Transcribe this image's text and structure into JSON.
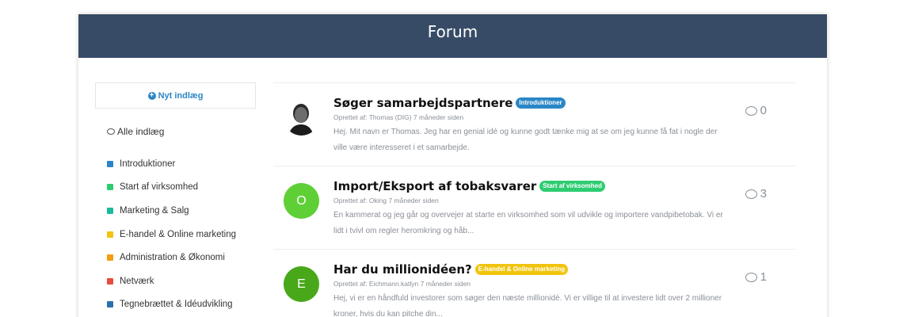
{
  "header": {
    "title": "Forum"
  },
  "sidebar": {
    "new_post_label": "Nyt indlæg",
    "all_posts_label": "Alle indlæg",
    "categories": [
      {
        "label": "Introduktioner",
        "color": "#2a86c6"
      },
      {
        "label": "Start af virksomhed",
        "color": "#2ecc71"
      },
      {
        "label": "Marketing & Salg",
        "color": "#1abc9c"
      },
      {
        "label": "E-handel & Online marketing",
        "color": "#f1c40f"
      },
      {
        "label": "Administration & Økonomi",
        "color": "#f39c12"
      },
      {
        "label": "Netværk",
        "color": "#e74c3c"
      },
      {
        "label": "Tegnebrættet & Idéudvikling",
        "color": "#2a6fb0"
      }
    ]
  },
  "posts": [
    {
      "title": "Søger samarbejdspartnere",
      "badge": "Introduktioner",
      "badge_color": "#2a86c6",
      "meta": "Oprettet af: Thomas (DIG) 7 måneder siden",
      "excerpt": "Hej. Mit navn er Thomas. Jeg har en genial idé og kunne godt tænke mig at se om jeg kunne få fat i nogle der ville være interesseret i et samarbejde.",
      "avatar_type": "photo",
      "comments": "0"
    },
    {
      "title": "Import/Eksport af tobaksvarer",
      "badge": "Start af virksomhed",
      "badge_color": "#2ecc71",
      "meta": "Oprettet af: Oking 7 måneder siden",
      "excerpt": "En kammerat og jeg går og overvejer at starte en virksomhed som vil udvikle og importere vandpibetobak. Vi er lidt i tvivl om regler heromkring og håb...",
      "avatar_type": "letter",
      "avatar_letter": "O",
      "avatar_color": "#5fcf36",
      "comments": "3"
    },
    {
      "title": "Har du millionidéen?",
      "badge": "E-handel & Online marketing",
      "badge_color": "#f1c40f",
      "meta": "Oprettet af: Eichmann.katlyn 7 måneder siden",
      "excerpt": "Hej, vi er en håndfuld investorer som søger den næste millionidé. Vi er villige til at investere lidt over 2 millioner kroner, hvis du kan pitche din...",
      "avatar_type": "letter",
      "avatar_letter": "E",
      "avatar_color": "#48a81a",
      "comments": "1"
    }
  ]
}
